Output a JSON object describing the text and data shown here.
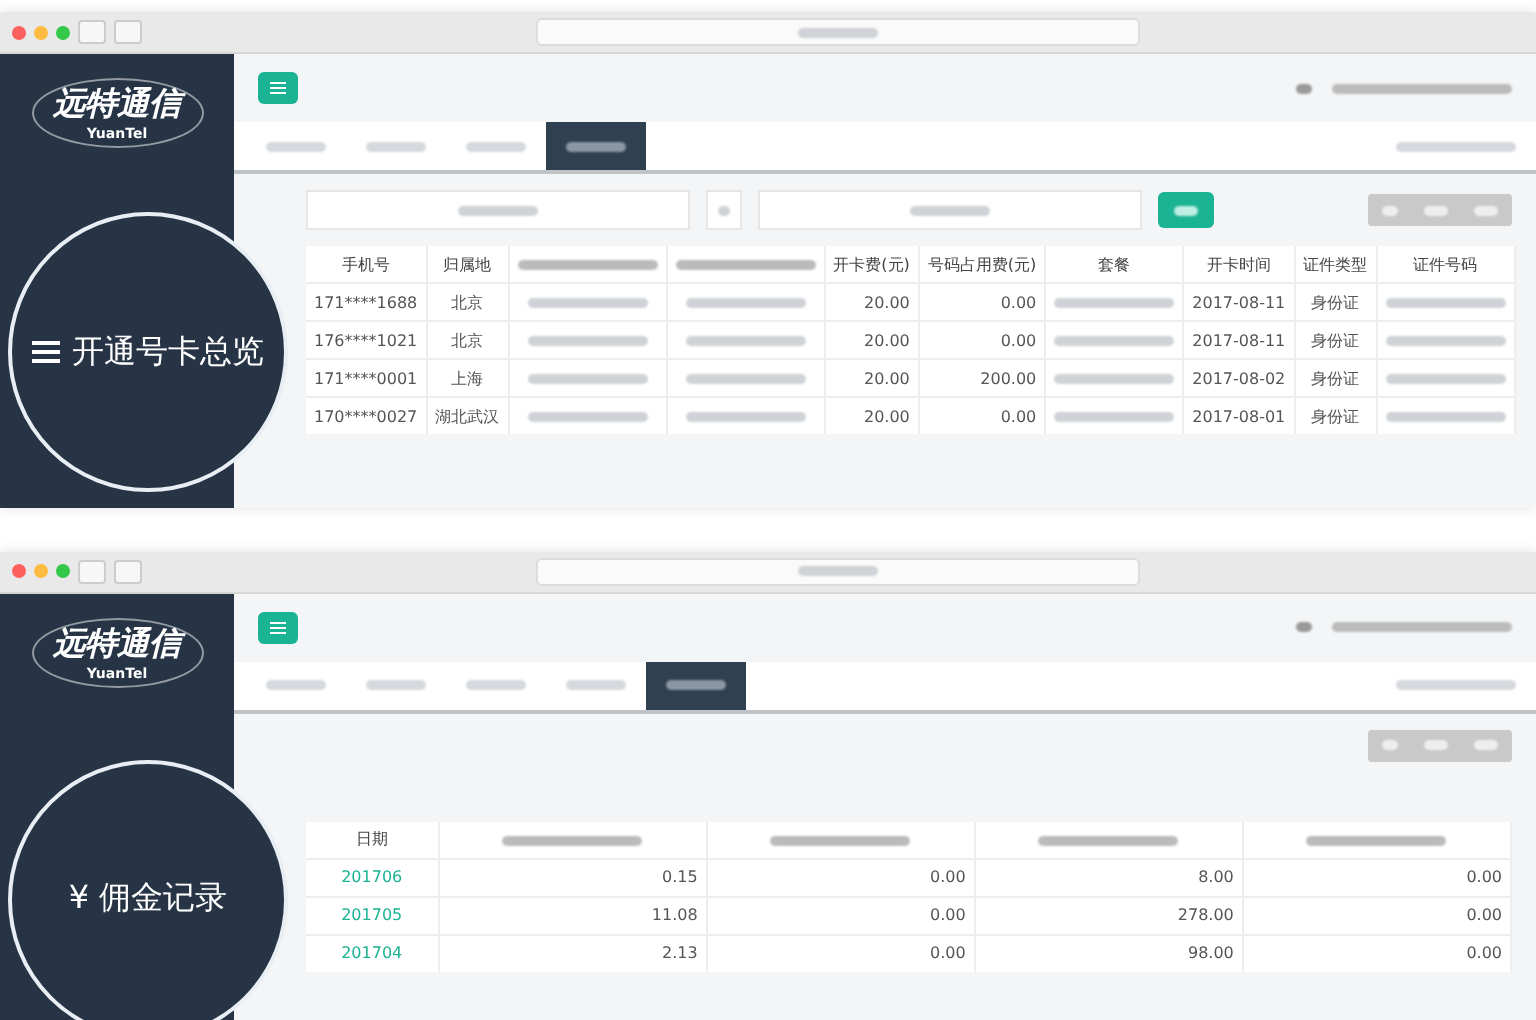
{
  "windows": [
    {
      "logo": {
        "name": "远特通信",
        "sub": "YuanTel"
      },
      "tabs": [
        {
          "selected": false
        },
        {
          "selected": false
        },
        {
          "selected": false
        },
        {
          "selected": true
        }
      ],
      "magnifier": {
        "kind": "menu",
        "label": "开通号卡总览"
      },
      "search": true,
      "table": {
        "columns": [
          {
            "label": "手机号",
            "kind": "text"
          },
          {
            "label": "归属地",
            "kind": "text"
          },
          {
            "kind": "text"
          },
          {
            "kind": "text"
          },
          {
            "label": "开卡费(元)",
            "kind": "number"
          },
          {
            "label": "号码占用费(元)",
            "kind": "number"
          },
          {
            "label": "套餐",
            "kind": "text"
          },
          {
            "label": "开卡时间",
            "kind": "text"
          },
          {
            "label": "证件类型",
            "kind": "text"
          },
          {
            "label": "证件号码",
            "kind": "text"
          }
        ],
        "rows": [
          {
            "cells": [
              "171****1688",
              "北京",
              "",
              "",
              "20.00",
              "0.00",
              "",
              "2017-08-11",
              "身份证",
              ""
            ]
          },
          {
            "cells": [
              "176****1021",
              "北京",
              "",
              "",
              "20.00",
              "0.00",
              "",
              "2017-08-11",
              "身份证",
              ""
            ]
          },
          {
            "cells": [
              "171****0001",
              "上海",
              "",
              "",
              "20.00",
              "200.00",
              "",
              "2017-08-02",
              "身份证",
              ""
            ]
          },
          {
            "cells": [
              "170****0027",
              "湖北武汉",
              "",
              "",
              "20.00",
              "0.00",
              "",
              "2017-08-01",
              "身份证",
              ""
            ]
          }
        ]
      }
    },
    {
      "logo": {
        "name": "远特通信",
        "sub": "YuanTel"
      },
      "tabs": [
        {
          "selected": false
        },
        {
          "selected": false
        },
        {
          "selected": false
        },
        {
          "selected": false
        },
        {
          "selected": true
        }
      ],
      "magnifier": {
        "kind": "text",
        "label": "¥ 佣金记录"
      },
      "search": false,
      "table": {
        "columns": [
          {
            "label": "日期",
            "kind": "link"
          },
          {
            "kind": "number"
          },
          {
            "kind": "number"
          },
          {
            "kind": "number"
          },
          {
            "kind": "number"
          }
        ],
        "rows": [
          {
            "cells": [
              "201706",
              "0.15",
              "0.00",
              "8.00",
              "0.00"
            ]
          },
          {
            "cells": [
              "201705",
              "11.08",
              "0.00",
              "278.00",
              "0.00"
            ]
          },
          {
            "cells": [
              "201704",
              "2.13",
              "0.00",
              "98.00",
              "0.00"
            ]
          }
        ]
      }
    }
  ]
}
